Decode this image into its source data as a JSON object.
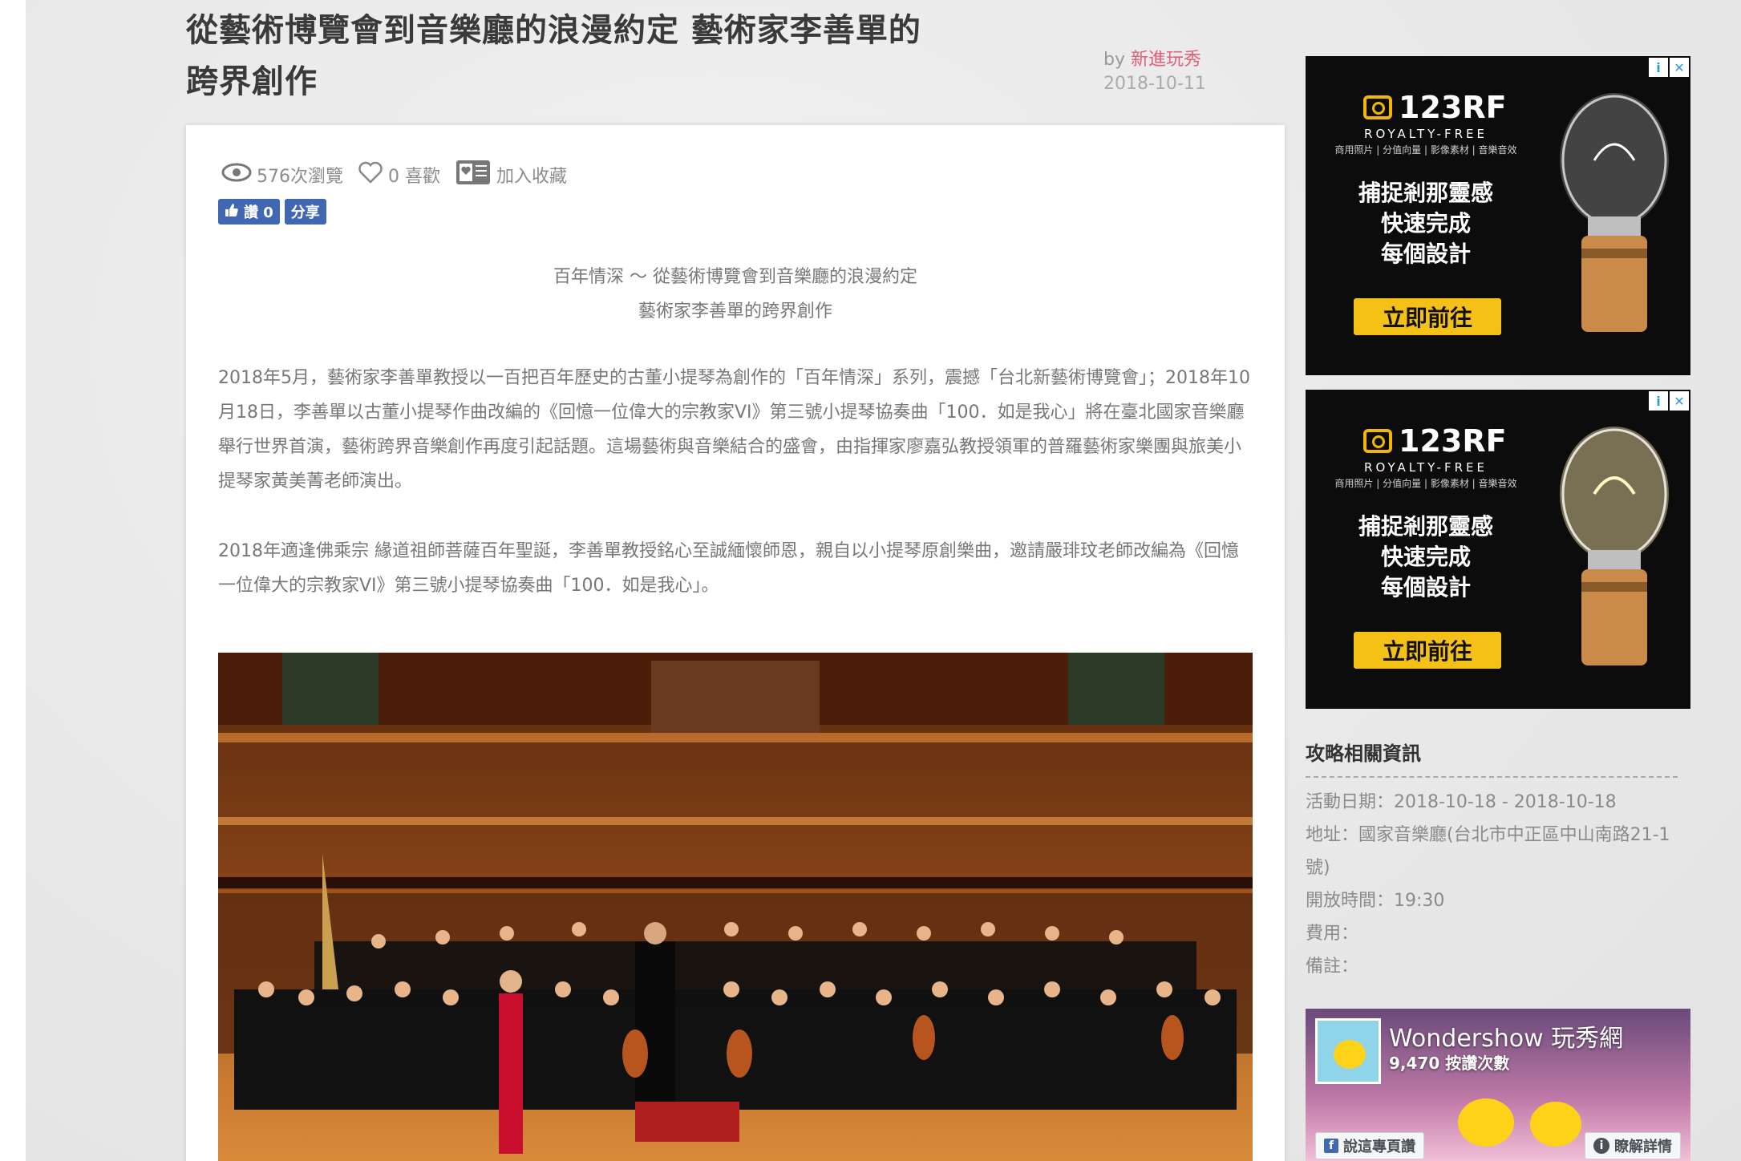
{
  "article": {
    "title_line1": "從藝術博覽會到音樂廳的浪漫約定 藝術家李善單的",
    "title_line2": "跨界創作",
    "by_label": "by",
    "author": "新進玩秀",
    "date": "2018-10-11"
  },
  "stats": {
    "views": "576次瀏覽",
    "likes": "0 喜歡",
    "favorite": "加入收藏"
  },
  "facebook_buttons": {
    "like_label": "讚 0",
    "share_label": "分享"
  },
  "body": {
    "intro_line1": "百年情深 ～ 從藝術博覽會到音樂廳的浪漫約定",
    "intro_line2": "藝術家李善單的跨界創作",
    "paragraph1": "2018年5月，藝術家李善單教授以一百把百年歷史的古董小提琴為創作的「百年情深」系列，震撼「台北新藝術博覽會」；2018年10月18日，李善單以古董小提琴作曲改編的《回憶一位偉大的宗教家VI》第三號小提琴協奏曲「100．如是我心」將在臺北國家音樂廳舉行世界首演，藝術跨界音樂創作再度引起話題。這場藝術與音樂結合的盛會，由指揮家廖嘉弘教授領軍的普羅藝術家樂團與旅美小提琴家黃美菁老師演出。",
    "paragraph2": " 2018年適逢佛乘宗 緣道祖師菩薩百年聖誕，李善單教授銘心至誠緬懷師恩，親自以小提琴原創樂曲，邀請嚴琲玟老師改編為《回憶一位偉大的宗教家VI》第三號小提琴協奏曲「100．如是我心」。"
  },
  "ads": [
    {
      "brand": "123RF",
      "tagline": "ROYALTY-FREE",
      "categories": "商用照片 | 分值向量 | 影像素材 | 音樂音效",
      "slogan1": "捕捉剎那靈感",
      "slogan2": "快速完成",
      "slogan3": "每個設計",
      "cta": "立即前往"
    },
    {
      "brand": "123RF",
      "tagline": "ROYALTY-FREE",
      "categories": "商用照片 | 分值向量 | 影像素材 | 音樂音效",
      "slogan1": "捕捉剎那靈感",
      "slogan2": "快速完成",
      "slogan3": "每個設計",
      "cta": "立即前往"
    }
  ],
  "info": {
    "heading": "攻略相關資訊",
    "date_row": "活動日期：2018-10-18 - 2018-10-18",
    "address_row": "地址：國家音樂廳(台北市中正區中山南路21-1號)",
    "hours_row": "開放時間：19:30",
    "fee_row": "費用：",
    "note_row": "備註："
  },
  "fb_widget": {
    "page_name": "Wondershow 玩秀網",
    "like_count": "9,470 按讚次數",
    "like_page": "說這專頁讚",
    "learn_more": "瞭解詳情"
  },
  "colors": {
    "accent_author": "#e0607a",
    "facebook_blue": "#4267b2",
    "ad_cta_yellow": "#f6c116"
  },
  "icons": [
    "eye-icon",
    "heart-icon",
    "bookmark-icon",
    "thumbs-up-icon",
    "bulb-image",
    "ad-info-icon",
    "ad-close-icon"
  ]
}
